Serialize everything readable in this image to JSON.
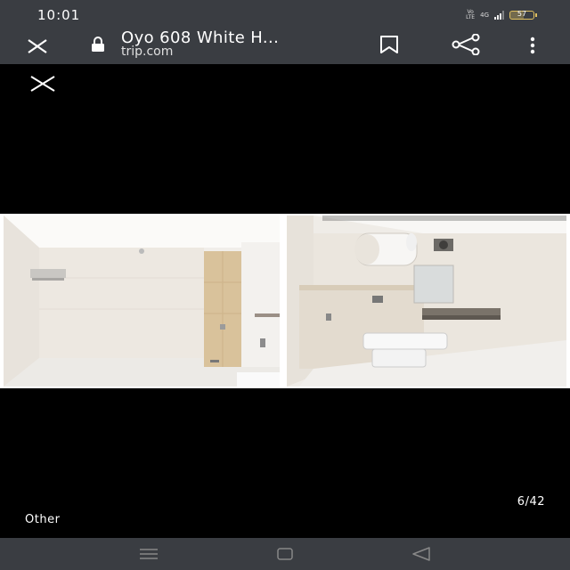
{
  "status_bar": {
    "time": "10:01",
    "volte_top": "Vo",
    "volte_bottom": "LTE",
    "network": "4G",
    "battery_level": 57,
    "battery_label": "57"
  },
  "browser": {
    "title": "Oyo 608 White H...",
    "domain": "trip.com"
  },
  "gallery": {
    "caption": "Other",
    "counter": "6/42"
  },
  "colors": {
    "bar_bg": "#3a3d42",
    "viewer_bg": "#000000",
    "battery": "#e0c060"
  },
  "icons": {
    "close": "close-icon",
    "lock": "lock-icon",
    "bookmark": "bookmark-icon",
    "share": "share-icon",
    "menu": "more-vert-icon",
    "viewer_close": "close-icon",
    "nav_recents": "menu-lines-icon",
    "nav_home": "square-icon",
    "nav_back": "triangle-back-icon"
  }
}
